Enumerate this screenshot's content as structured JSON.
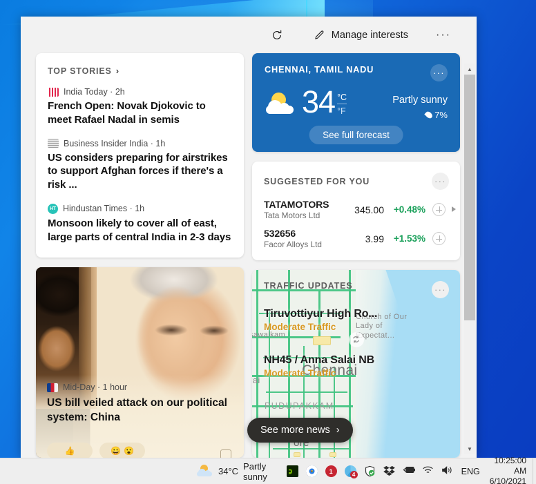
{
  "header": {
    "refresh_icon": "refresh-icon",
    "manage_interests_label": "Manage interests",
    "pencil_icon": "pencil-icon",
    "more_options": "···"
  },
  "top_stories": {
    "label": "TOP STORIES",
    "chevron": "›",
    "items": [
      {
        "source": "India Today · 2h",
        "headline": "French Open: Novak Djokovic to meet Rafael Nadal in semis"
      },
      {
        "source": "Business Insider India · 1h",
        "headline": "US considers preparing for airstrikes to support Afghan forces if there's a risk ..."
      },
      {
        "source": "Hindustan Times · 1h",
        "headline": "Monsoon likely to cover all of east, large parts of central India in 2-3 days"
      }
    ]
  },
  "weather_card": {
    "city": "CHENNAI, TAMIL NADU",
    "more_options": "···",
    "temperature": "34",
    "unit_celsius": "°C",
    "unit_fahrenheit": "°F",
    "condition": "Partly sunny",
    "precipitation": "7%",
    "forecast_button": "See full forecast",
    "accent_color": "#1a6ab5"
  },
  "stocks_card": {
    "label": "SUGGESTED FOR YOU",
    "more_options": "···",
    "rows": [
      {
        "symbol": "TATAMOTORS",
        "company": "Tata Motors Ltd",
        "price": "345.00",
        "change": "+0.48%"
      },
      {
        "symbol": "532656",
        "company": "Facor Alloys Ltd",
        "price": "3.99",
        "change": "+1.53%"
      }
    ],
    "gain_color": "#1aa05a"
  },
  "news_photo_card": {
    "source": "Mid-Day · 1 hour",
    "headline": "US bill veiled attack on our political system: China"
  },
  "traffic_card": {
    "label": "TRAFFIC UPDATES",
    "more_options": "···",
    "items": [
      {
        "road": "Tiruvottiyur High Ro...",
        "status": "Moderate Traffic"
      },
      {
        "road": "NH45 / Anna Salai NB",
        "status": "Moderate Traffic"
      }
    ],
    "status_color": "#d99923",
    "map_labels": {
      "church": "Church of Our Lady of Expectat...",
      "vysarpadi": "sawalkam",
      "chennai": "Chennai",
      "pudupakkam": "PUDUPAKKAM",
      "left_edge": "rai",
      "bottom": "ore"
    }
  },
  "see_more_news": {
    "label": "See more news",
    "chevron": "›"
  },
  "taskbar": {
    "weather_temp": "34°C",
    "weather_condition": "Partly sunny",
    "tray_icons": [
      "nvidia-icon",
      "chrome-icon",
      "notification-badge-icon",
      "edge-icon",
      "windows-defender-icon",
      "dropbox-icon",
      "battery-charging-icon",
      "wifi-icon",
      "volume-icon"
    ],
    "badge_1": "1",
    "badge_2": "4",
    "language": "ENG",
    "time": "10:25:00 AM",
    "date": "6/10/2021"
  }
}
